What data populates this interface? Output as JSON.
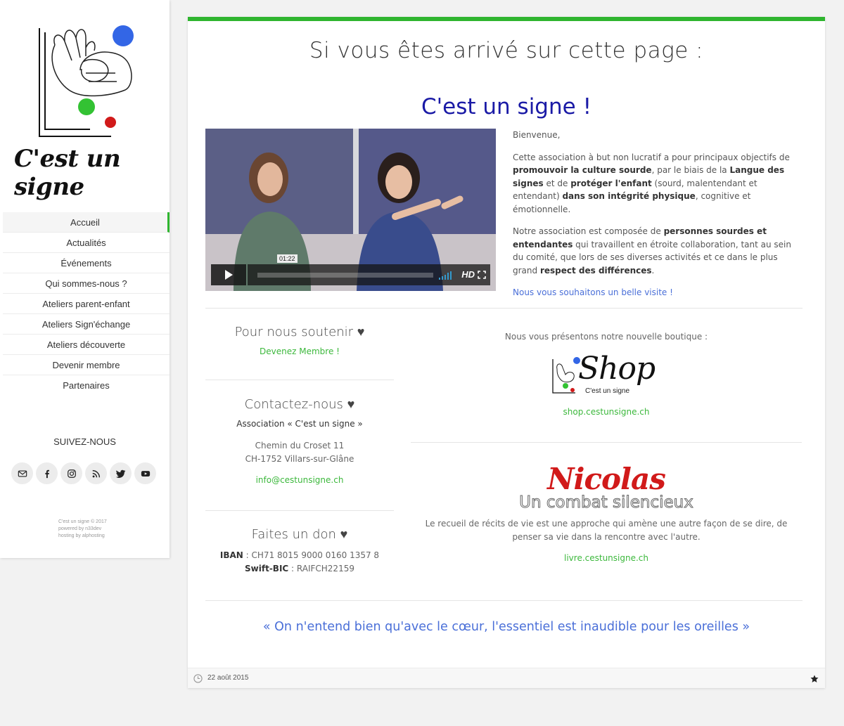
{
  "brand": {
    "name": "C'est un signe"
  },
  "sidebar": {
    "items": [
      {
        "label": "Accueil"
      },
      {
        "label": "Actualités"
      },
      {
        "label": "Événements"
      },
      {
        "label": "Qui sommes-nous ?"
      },
      {
        "label": "Ateliers parent-enfant"
      },
      {
        "label": "Ateliers Sign'échange"
      },
      {
        "label": "Ateliers découverte"
      },
      {
        "label": "Devenir membre"
      },
      {
        "label": "Partenaires"
      }
    ],
    "follow_label": "SUIVEZ-NOUS",
    "socials": [
      "envelope-icon",
      "facebook-icon",
      "instagram-icon",
      "rss-icon",
      "twitter-icon",
      "youtube-icon"
    ],
    "copyright": [
      "C'est un signe © 2017",
      "powered by n33dev",
      "hosting by alphosting"
    ]
  },
  "main": {
    "title": "Si vous êtes arrivé sur cette page :",
    "subtitle": "C'est un signe !",
    "video": {
      "time": "01:22",
      "quality": "HD"
    },
    "intro": {
      "greeting": "Bienvenue,",
      "p1": [
        "Cette association à but non lucratif a pour principaux objectifs de ",
        "promouvoir la culture sourde",
        ", par le biais de la ",
        "Langue des signes",
        " et de ",
        "protéger l'enfant",
        " (sourd, malentendant et entendant) ",
        "dans son intégrité physique",
        ", cognitive et émotionnelle."
      ],
      "p2": [
        "Notre association est composée de ",
        "personnes sourdes et entendantes",
        " qui travaillent en étroite collaboration, tant au sein du comité, que lors de ses diverses activités et ce dans le plus grand ",
        "respect des différences",
        "."
      ],
      "p3": "Nous vous souhaitons un belle visite !"
    },
    "support": {
      "title": "Pour nous soutenir ♥",
      "link": "Devenez Membre !"
    },
    "contact": {
      "title": "Contactez-nous ♥",
      "org_label": "Association « C'est un signe »",
      "street": "Chemin du Croset 11",
      "city": "CH-1752 Villars-sur-Glâne",
      "email": "info@cestunsigne.ch"
    },
    "donate": {
      "title": "Faites un don ♥",
      "iban_label": "IBAN",
      "iban": " : CH71 8015 9000 0160 1357 8",
      "swift_label": "Swift-BIC",
      "swift": " : RAIFCH22159"
    },
    "shop": {
      "intro": "Nous vous présentons notre nouvelle boutique :",
      "logo_word": "Shop",
      "logo_sub": "C'est un signe",
      "link": "shop.cestunsigne.ch"
    },
    "book": {
      "name": "Nicolas",
      "subtitle": "Un combat silencieux",
      "desc": "Le recueil de récits de vie est une approche qui amène une autre façon de se dire, de penser sa vie dans la rencontre avec l'autre.",
      "link": "livre.cestunsigne.ch"
    },
    "quote": "« On n'entend bien qu'avec le cœur, l'essentiel est inaudible pour les oreilles »",
    "footer": {
      "date": "22 août 2015"
    }
  },
  "colors": {
    "accent": "#2fb52f",
    "link_blue": "#4a6fd8",
    "title_blue": "#1a1aa6",
    "nicolas_red": "#d11a1a"
  }
}
